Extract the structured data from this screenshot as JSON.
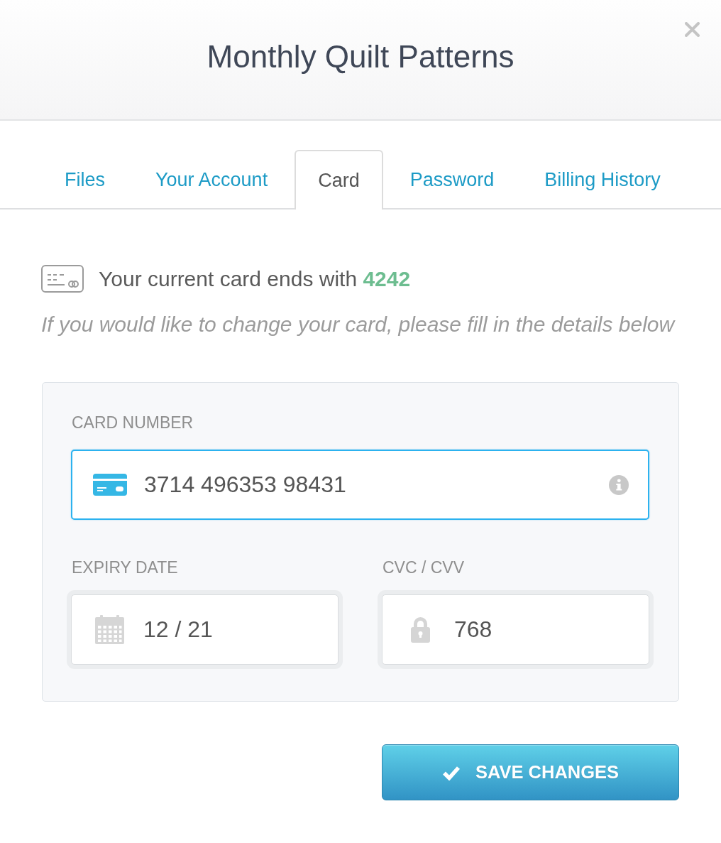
{
  "dialog": {
    "title": "Monthly Quilt Patterns"
  },
  "tabs": [
    {
      "label": "Files",
      "selected": false
    },
    {
      "label": "Your Account",
      "selected": false
    },
    {
      "label": "Card",
      "selected": true
    },
    {
      "label": "Password",
      "selected": false
    },
    {
      "label": "Billing History",
      "selected": false
    }
  ],
  "current_card": {
    "text": "Your current card ends with **4242**"
  },
  "hint": "If you would like to change your card, please fill in the details below",
  "form": {
    "fields": [
      {
        "kind": "card",
        "label": "CARD NUMBER",
        "value": "3714 496353 98431",
        "focused": true
      },
      {
        "kind": "expiry",
        "label": "EXPIRY DATE",
        "value": "12 / 21",
        "focused": false
      },
      {
        "kind": "cvc",
        "label": "CVC / CVV",
        "value": "768",
        "focused": false
      }
    ]
  },
  "save_button": {
    "label": "SAVE CHANGES"
  }
}
